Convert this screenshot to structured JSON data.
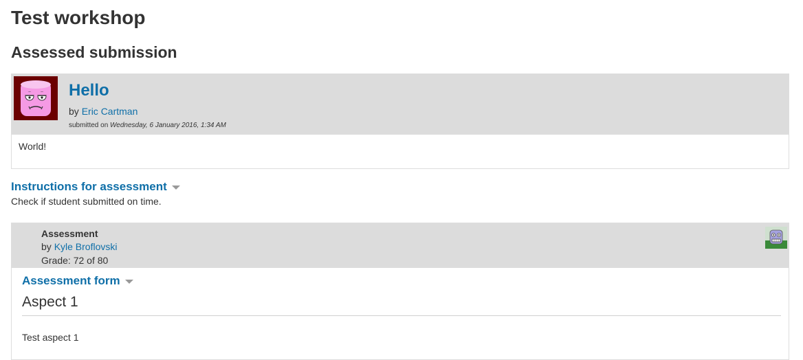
{
  "page": {
    "title": "Test workshop",
    "section_title": "Assessed submission"
  },
  "submission": {
    "title": "Hello",
    "by_prefix": "by ",
    "author": "Eric Cartman",
    "submitted_prefix": "submitted on ",
    "submitted_date": "Wednesday, 6 January 2016, 1:34 AM",
    "content": "World!",
    "avatar_icon": "marshmallow-face-avatar-icon"
  },
  "instructions": {
    "heading": "Instructions for assessment",
    "text": "Check if student submitted on time."
  },
  "assessment": {
    "title": "Assessment",
    "by_prefix": "by ",
    "reviewer": "Kyle Broflovski",
    "grade": "Grade: 72 of 80",
    "avatar_icon": "robot-face-avatar-icon",
    "form_heading": "Assessment form",
    "aspect_title": "Aspect 1",
    "aspect_text": "Test aspect 1"
  },
  "colors": {
    "link": "#0f6fa8",
    "header_bg": "#dcdcdc",
    "text": "#333333"
  }
}
